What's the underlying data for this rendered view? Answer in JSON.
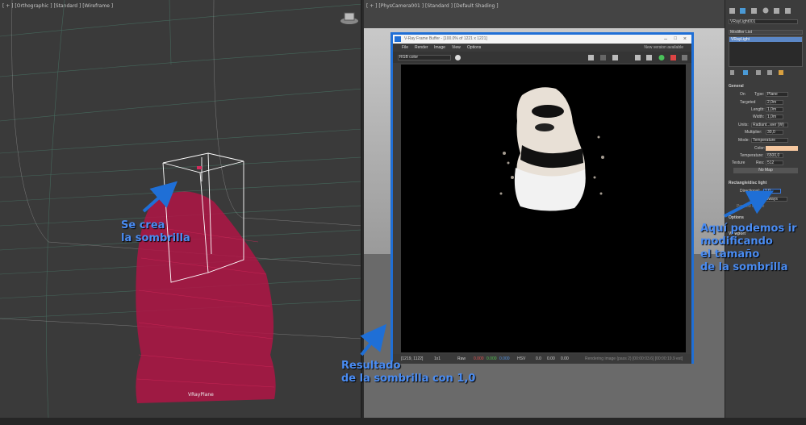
{
  "left_viewport": {
    "label": "[ + ] [Orthographic ] [Standard ] [Wireframe ]",
    "object_label": "VRayPlane"
  },
  "right_viewport": {
    "label": "[ + ] [PhysCamera001 ] [Standard ] [Default Shading ]"
  },
  "vfb": {
    "title": "V-Ray Frame Buffer - [100.0% of 1221 x 1221]",
    "menu": [
      "File",
      "Render",
      "Image",
      "View",
      "Options"
    ],
    "new_version": "New version available",
    "channel": "RGB color",
    "status_coords": "[1219, 1122]",
    "status_scale": "1x1",
    "status_mode": "Raw",
    "status_r": "0.000",
    "status_g": "0.000",
    "status_b": "0.000",
    "status_space": "HSV",
    "status_h": "0.0",
    "status_s": "0.00",
    "status_v": "0.00",
    "status_msg": "Rendering image (pass 2) [00:00:03.6] [00:00:19.9 est]"
  },
  "command_panel": {
    "object_name": "VRayLight001",
    "modifier_list": "Modifier List",
    "stack_item": "VRayLight",
    "general_title": "General",
    "on_label": "On",
    "type_label": "Type:",
    "type_value": "Plane",
    "targeted_label": "Targeted",
    "targeted_value": "2,0m",
    "length_label": "Length:",
    "length_value": "1,0m",
    "width_label": "Width:",
    "width_value": "1,0m",
    "units_label": "Units:",
    "units_value": "Radiant...wer (W)",
    "multiplier_label": "Multiplier:",
    "multiplier_value": "30,0",
    "mode_label": "Mode:",
    "mode_value": "Temperature",
    "color_label": "Color:",
    "temperature_label": "Temperature:",
    "temperature_value": "6500,0",
    "texture_label": "Texture",
    "res_label": "Res:",
    "res_value": "512",
    "no_map": "No Map",
    "rect_title": "Rectangle/disc light",
    "directional_label": "Directional:",
    "directional_value": "1,0",
    "always_value": "Always",
    "preview_label": "Preview texture",
    "options_title": "Options",
    "viewport_title": "Viewport",
    "light_color": "#f6c8a0"
  },
  "annotations": {
    "sombrilla_line1": "Se crea",
    "sombrilla_line2": "la sombrilla",
    "resultado_line1": "Resultado",
    "resultado_line2": "de la sombrilla con 1,0",
    "aqui_line1": "Aquí podemos ir",
    "aqui_line2": "modificando",
    "aqui_line3": "el tamaño",
    "aqui_line4": "de la sombrilla"
  },
  "colors": {
    "accent": "#1f6fd6",
    "annotation": "#4a8cf2",
    "wireframe": "#c8184a"
  }
}
